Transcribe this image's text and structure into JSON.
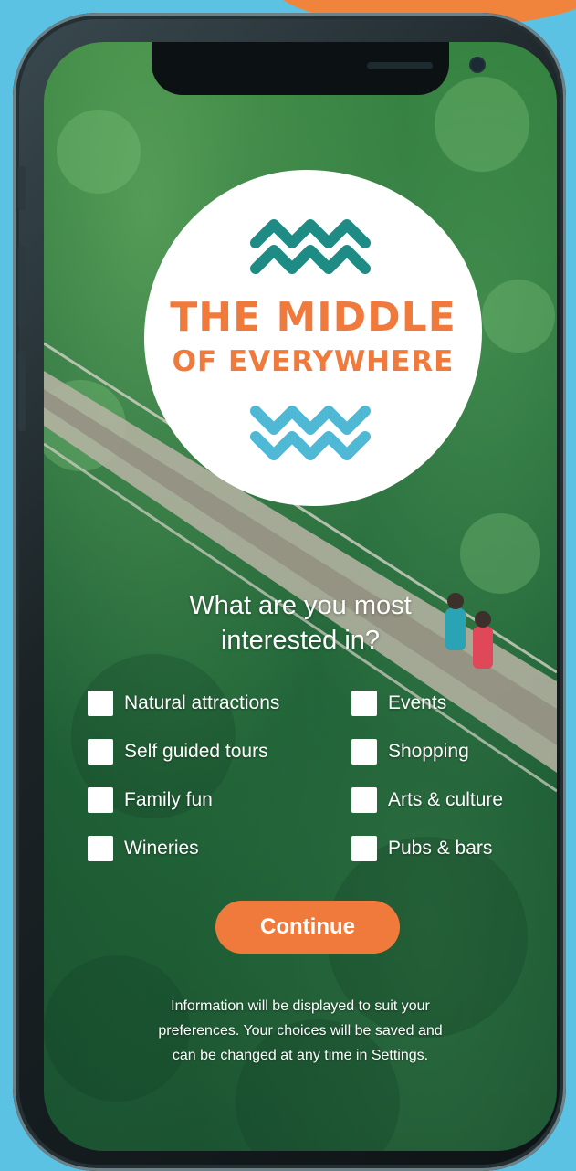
{
  "colors": {
    "accent_orange": "#f07a3c",
    "teal": "#1e8c84",
    "light_blue": "#4fb8d4",
    "background_blue": "#5bc2e4"
  },
  "logo": {
    "line1": "THE MIDDLE",
    "line2": "OF EVERYWHERE",
    "top_icon": "zigzag-waves-icon",
    "bottom_icon": "zigzag-waves-icon"
  },
  "question": {
    "line1": "What are you most",
    "line2": "interested in?"
  },
  "options": {
    "left": [
      {
        "label": "Natural attractions",
        "checked": false
      },
      {
        "label": "Self guided tours",
        "checked": false
      },
      {
        "label": "Family fun",
        "checked": false
      },
      {
        "label": "Wineries",
        "checked": false
      }
    ],
    "right": [
      {
        "label": "Events",
        "checked": false
      },
      {
        "label": "Shopping",
        "checked": false
      },
      {
        "label": "Arts & culture",
        "checked": false
      },
      {
        "label": "Pubs & bars",
        "checked": false
      }
    ]
  },
  "continue_button": {
    "label": "Continue"
  },
  "info": {
    "line1": "Information will be displayed to suit your",
    "line2": "preferences. Your choices will be saved and",
    "line3": "can be changed at any time in Settings."
  }
}
